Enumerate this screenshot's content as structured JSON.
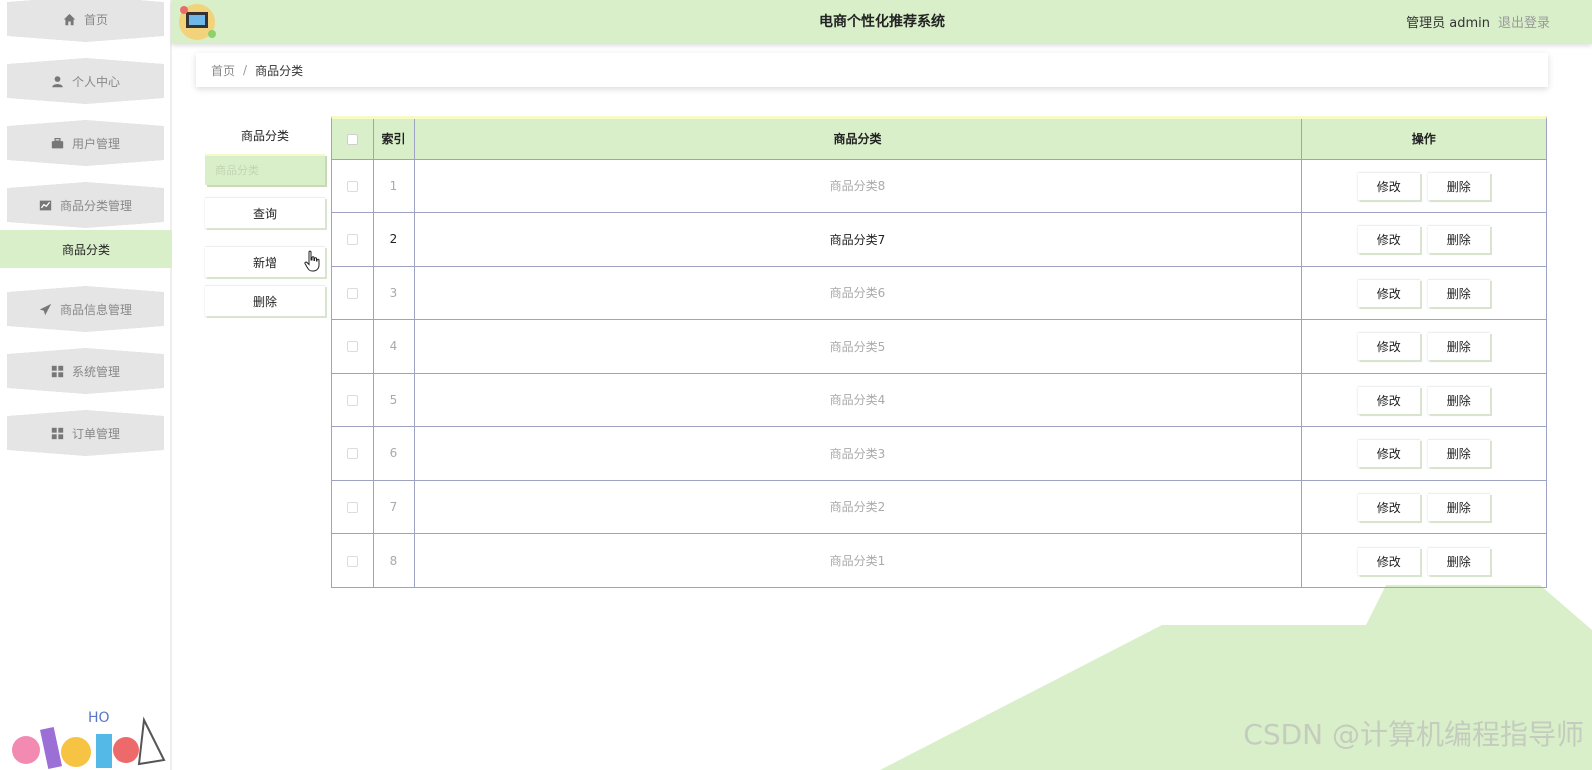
{
  "sidebar": {
    "items": [
      {
        "label": "首页",
        "icon": "home-icon"
      },
      {
        "label": "个人中心",
        "icon": "user-icon"
      },
      {
        "label": "用户管理",
        "icon": "briefcase-icon"
      },
      {
        "label": "商品分类管理",
        "icon": "chart-icon"
      },
      {
        "label": "商品信息管理",
        "icon": "send-icon"
      },
      {
        "label": "系统管理",
        "icon": "grid-icon"
      },
      {
        "label": "订单管理",
        "icon": "grid-icon"
      }
    ],
    "active_sub": "商品分类"
  },
  "header": {
    "title": "电商个性化推荐系统",
    "user": "管理员 admin",
    "logout": "退出登录"
  },
  "breadcrumb": {
    "home": "首页",
    "separator": "/",
    "current": "商品分类"
  },
  "search": {
    "label": "商品分类",
    "placeholder": "商品分类",
    "query_button": "查询",
    "add_button": "新增",
    "delete_button": "删除"
  },
  "table": {
    "columns": [
      "索引",
      "商品分类",
      "操作"
    ],
    "rows": [
      {
        "index": "1",
        "category": "商品分类8"
      },
      {
        "index": "2",
        "category": "商品分类7"
      },
      {
        "index": "3",
        "category": "商品分类6"
      },
      {
        "index": "4",
        "category": "商品分类5"
      },
      {
        "index": "5",
        "category": "商品分类4"
      },
      {
        "index": "6",
        "category": "商品分类3"
      },
      {
        "index": "7",
        "category": "商品分类2"
      },
      {
        "index": "8",
        "category": "商品分类1"
      }
    ],
    "edit_label": "修改",
    "delete_label": "删除"
  },
  "watermark": "CSDN @计算机编程指导师",
  "colors": {
    "accent": "#d9efca",
    "border": "#9ea3c3",
    "menu_bg": "#e5e5e5"
  }
}
